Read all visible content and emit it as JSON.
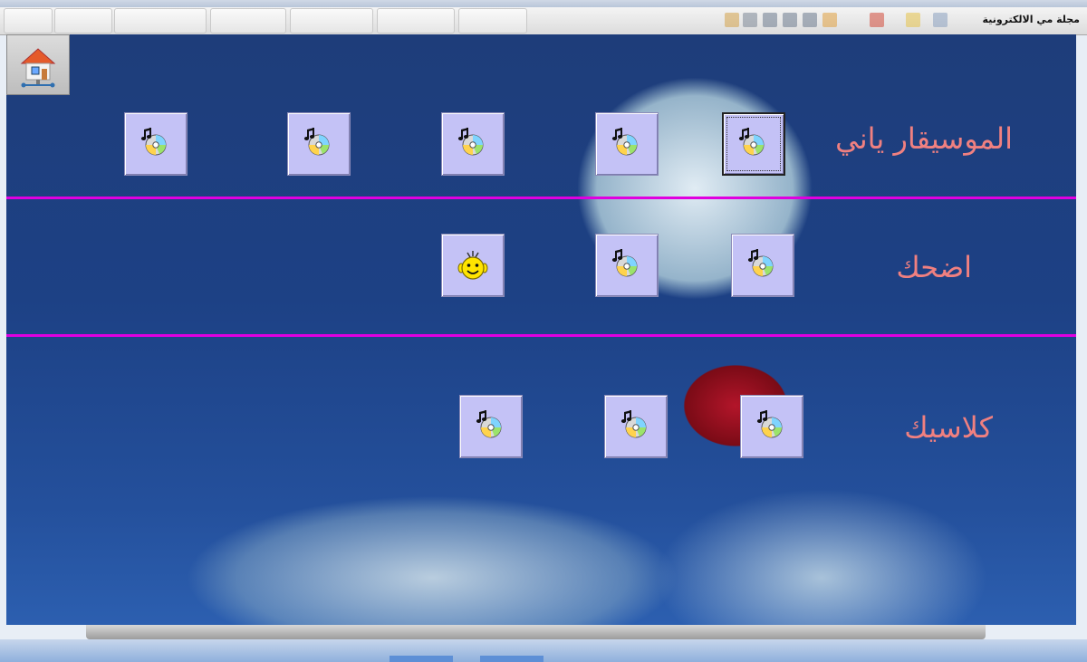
{
  "window": {
    "title": "مجلة مي الالكترونية"
  },
  "home_button": {
    "icon": "home-network-icon"
  },
  "rows": [
    {
      "label": "الموسيقار ياني",
      "buttons": [
        {
          "icon": "music-cd-icon"
        },
        {
          "icon": "music-cd-icon"
        },
        {
          "icon": "music-cd-icon"
        },
        {
          "icon": "music-cd-icon"
        },
        {
          "icon": "music-cd-icon",
          "focused": true
        }
      ]
    },
    {
      "label": "اضحك",
      "buttons": [
        {
          "icon": "smiley-face-icon"
        },
        {
          "icon": "music-cd-icon"
        },
        {
          "icon": "music-cd-icon"
        }
      ]
    },
    {
      "label": "كلاسيك",
      "buttons": [
        {
          "icon": "music-cd-icon"
        },
        {
          "icon": "music-cd-icon"
        },
        {
          "icon": "music-cd-icon"
        }
      ]
    }
  ],
  "colors": {
    "divider": "#e000e0",
    "label": "#f08080",
    "button_face": "#c4c2f6",
    "background": "#1e3d7a"
  }
}
